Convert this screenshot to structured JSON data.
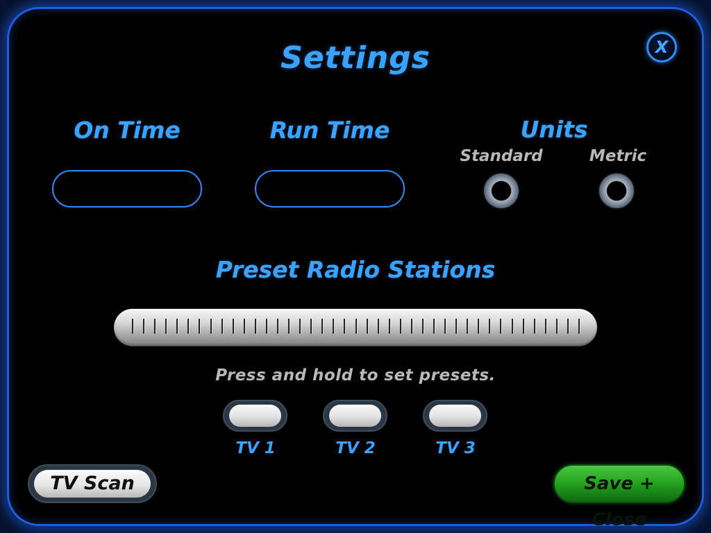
{
  "window": {
    "title": "Settings",
    "close_label": "X"
  },
  "settings": {
    "on_time": {
      "label": "On Time",
      "value": ""
    },
    "run_time": {
      "label": "Run Time",
      "value": ""
    },
    "units": {
      "label": "Units",
      "options": [
        "Standard",
        "Metric"
      ],
      "selected": null
    }
  },
  "radio_presets": {
    "title": "Preset Radio Stations",
    "hint": "Press and hold to set presets.",
    "presets": [
      "TV 1",
      "TV 2",
      "TV 3"
    ]
  },
  "footer": {
    "scan_label": "TV Scan",
    "save_label": "Save + Close"
  },
  "colors": {
    "accent": "#3aa2ff",
    "border": "#2f8cff",
    "background": "#000000",
    "save_button": "#24a01f",
    "muted_text": "#b8b8b8"
  }
}
